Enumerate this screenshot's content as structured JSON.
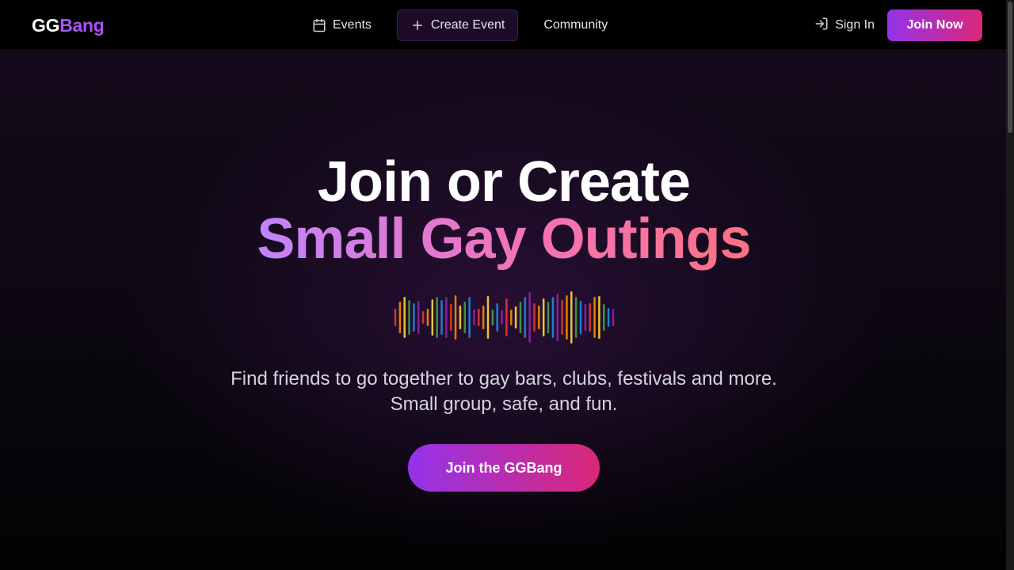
{
  "brand": {
    "part1": "GG",
    "part2": "Bang"
  },
  "nav": {
    "events": {
      "label": "Events",
      "icon": "calendar-icon"
    },
    "create_event": {
      "label": "Create Event",
      "icon": "plus-icon"
    },
    "community": {
      "label": "Community"
    }
  },
  "auth": {
    "sign_in": {
      "label": "Sign In",
      "icon": "sign-in-icon"
    },
    "join_now": "Join Now"
  },
  "hero": {
    "title_line1": "Join or Create",
    "title_line2": "Small Gay Outings",
    "subtitle_line1": "Find friends to go together to gay bars, clubs, festivals and more.",
    "subtitle_line2": "Small group, safe, and fun.",
    "cta": "Join the GGBang"
  },
  "colors": {
    "brand_purple": "#a855f7",
    "gradient_start": "#9333ea",
    "gradient_end": "#db2777",
    "rainbow": [
      "#e53935",
      "#fb8c00",
      "#fdd835",
      "#43a047",
      "#1e88e5",
      "#8e24aa"
    ]
  }
}
